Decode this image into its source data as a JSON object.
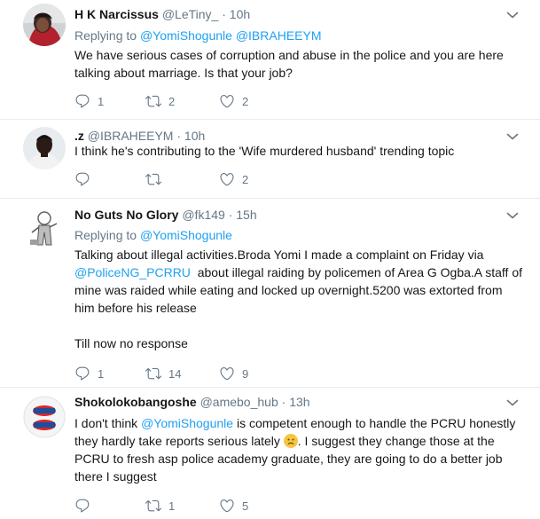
{
  "tweets": [
    {
      "name": "H K Narcissus",
      "handle": "@LeTiny_",
      "dot": "·",
      "time": "10h",
      "replying_prefix": "Replying to",
      "replying_to": [
        "@YomiShogunle",
        "@IBRAHEEYM"
      ],
      "text_lines": [
        "We have serious cases of corruption and abuse in the police and you are here",
        "talking about marriage. Is that your job?"
      ],
      "replies": "1",
      "retweets": "2",
      "likes": "2"
    },
    {
      "name": ".z",
      "handle": "@IBRAHEEYM",
      "dot": "·",
      "time": "10h",
      "text_lines": [
        "I think he's contributing to the 'Wife murdered husband' trending topic"
      ],
      "replies": "",
      "retweets": "",
      "likes": "2"
    },
    {
      "name": "No Guts No Glory",
      "handle": "@fk149",
      "dot": "·",
      "time": "15h",
      "replying_prefix": "Replying to",
      "replying_to": [
        "@YomiShogunle"
      ],
      "text_line1": "Talking about illegal activities.Broda Yomi I made a complaint on Friday via",
      "text_mention": "@PoliceNG_PCRRU",
      "text_line2_rest": "  about illegal raiding by policemen of Area G Ogba.A staff of",
      "text_line3": "mine was raided while eating and locked up overnight.5200 was extorted from",
      "text_line4": "him before his release",
      "text_line5": "Till now no response",
      "replies": "1",
      "retweets": "14",
      "likes": "9"
    },
    {
      "name": "Shokolokobangoshe",
      "handle": "@amebo_hub",
      "dot": "·",
      "time": "13h",
      "text_pre": "I don't think ",
      "text_mention": "@YomiShogunle",
      "text_line1_rest": " is competent enough to handle the PCRU honestly",
      "text_line2_pre": "they hardly take reports serious lately ",
      "text_line2_post": ". I suggest they change those at the",
      "text_line3": "PCRU to fresh asp police academy graduate, they are going to do a better job",
      "text_line4": "there I suggest",
      "replies": "",
      "retweets": "1",
      "likes": "5"
    }
  ],
  "icons": {
    "reply": "reply-icon",
    "retweet": "retweet-icon",
    "like": "heart-icon",
    "more": "chevron-down-icon"
  },
  "colors": {
    "link": "#1da1f2",
    "muted": "#657786",
    "text": "#14171a",
    "separator": "#e6ecf0"
  }
}
